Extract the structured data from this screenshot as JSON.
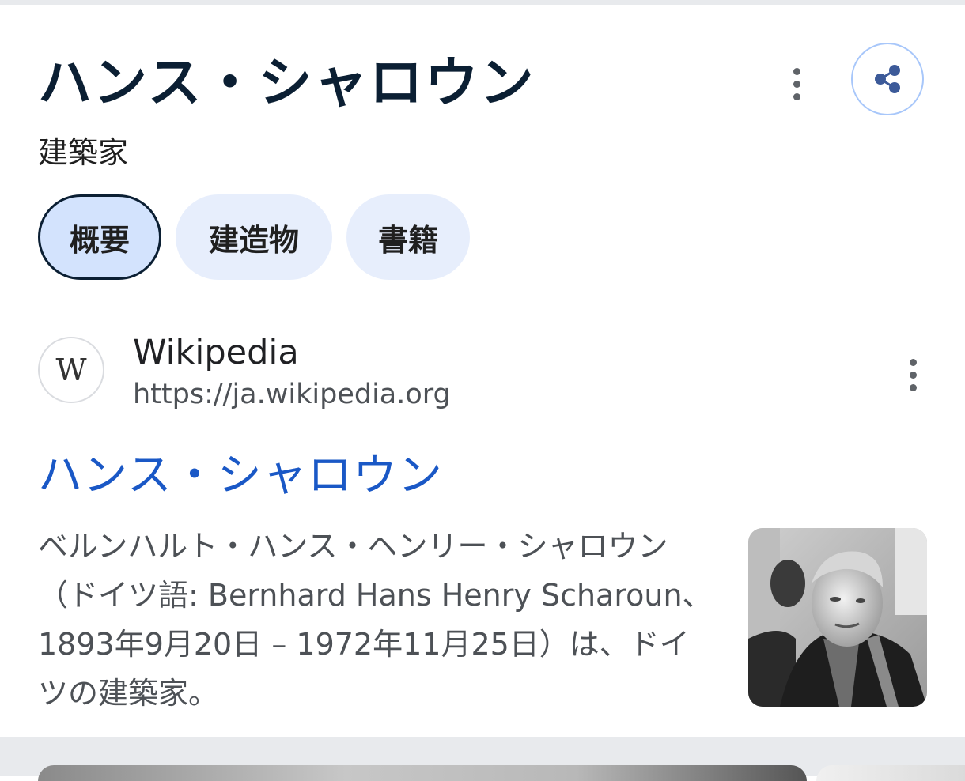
{
  "header": {
    "title": "ハンス・シャロウン",
    "subtitle": "建築家",
    "more_icon": "more-vert-icon",
    "share_icon": "share-icon"
  },
  "tabs": [
    {
      "label": "概要",
      "selected": true
    },
    {
      "label": "建造物",
      "selected": false
    },
    {
      "label": "書籍",
      "selected": false
    }
  ],
  "result": {
    "source_logo": "W",
    "source_name": "Wikipedia",
    "source_url": "https://ja.wikipedia.org",
    "title": "ハンス・シャロウン",
    "snippet": "ベルンハルト・ハンス・ヘンリー・シャロウン（ドイツ語: Bernhard Hans Henry Scharoun、1893年9月20日 – 1972年11月25日）は、ドイツの建築家。",
    "thumbnail": "portrait-photo"
  },
  "colors": {
    "title": "#0b1f33",
    "link": "#1a58c6",
    "chip_bg": "#e7eefc",
    "chip_active_bg": "#d3e3fd",
    "share_border": "#a8c7fa"
  }
}
